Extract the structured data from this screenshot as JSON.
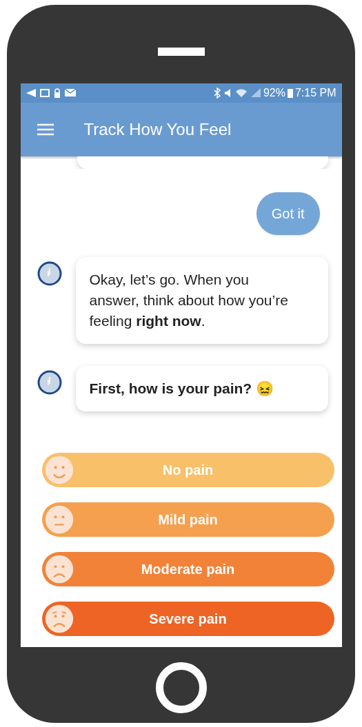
{
  "status_bar": {
    "battery": "92%",
    "time": "7:15 PM"
  },
  "app_bar": {
    "title": "Track How You Feel"
  },
  "messages": [
    {
      "kind": "reply",
      "text": "Got it",
      "bold": false
    },
    {
      "kind": "bubble",
      "text": "Okay, let’s go. When you answer, think about how you’re feeling **right now**.",
      "bold": false
    },
    {
      "kind": "bubble",
      "text": "First, how is your pain? 😖",
      "bold": true
    }
  ],
  "options": [
    {
      "label": "No pain",
      "kind": "smile",
      "color": "#f9c06a"
    },
    {
      "label": "Mild pain",
      "kind": "neutral",
      "color": "#f5a04e"
    },
    {
      "label": "Moderate pain",
      "kind": "frown",
      "color": "#f28238"
    },
    {
      "label": "Severe pain",
      "kind": "worried",
      "color": "#ee6424"
    }
  ]
}
